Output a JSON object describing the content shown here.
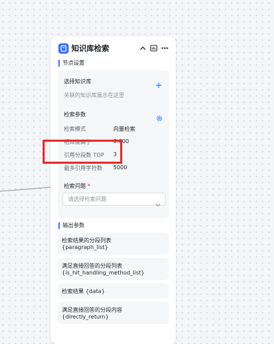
{
  "node": {
    "title": "知识库检索",
    "icon": "book-icon",
    "header_buttons": [
      "chevron-up-icon",
      "status-icon",
      "more-icon"
    ]
  },
  "node_settings": {
    "section_title": "节点设置",
    "knowledge": {
      "label": "选择知识库",
      "placeholder": "关联的知识库展示在这里",
      "add_icon": "plus-icon"
    },
    "params": {
      "label": "检索参数",
      "settings_icon": "gear-icon",
      "rows": [
        {
          "label": "检索模式",
          "value": "向量检索"
        },
        {
          "label": "相似度高于",
          "value": "0.600"
        },
        {
          "label": "引用分段数 TOP",
          "value": "3"
        },
        {
          "label": "最多引用字符数",
          "value": "5000"
        }
      ]
    },
    "question": {
      "label": "检索问题",
      "required_mark": "*",
      "placeholder": "请选择检索问题"
    }
  },
  "output": {
    "section_title": "输出参数",
    "items": [
      {
        "title": "检索结果的分段列表",
        "var": "{paragraph_list}"
      },
      {
        "title": "满足直接回答的分段列表",
        "var": "{is_hit_handling_method_list}"
      },
      {
        "title": "检索结果 {data}",
        "var": ""
      },
      {
        "title": "满足直接回答的分段内容",
        "var": "{directly_return}"
      }
    ]
  },
  "colors": {
    "accent": "#3370ff",
    "highlight": "#e52b2b",
    "canvas": "#f4f5f8"
  }
}
